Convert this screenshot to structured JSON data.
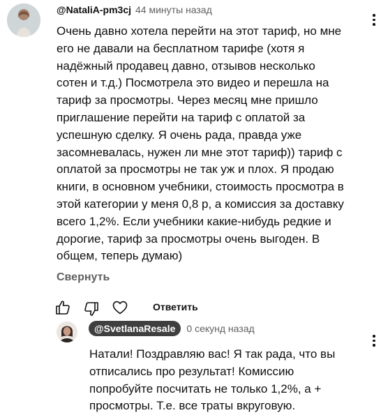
{
  "comment": {
    "author": "@NataliA-pm3cj",
    "time": "44 минуты назад",
    "lines": [
      "Очень давно хотела перейти на этот тариф, но мне",
      "его не давали на бесплатном тарифе (хотя я",
      "надёжный продавец давно, отзывов несколько",
      "сотен и т.д.) Посмотрела это видео и перешла на",
      "тариф за просмотры. Через месяц мне пришло",
      "приглашение перейти на тариф с оплатой за",
      "успешную сделку. Я очень рада, правда уже",
      "засомневалась, нужен ли мне этот тариф)) тариф с",
      "оплатой за просмотры не так уж и плох. Я продаю",
      "книги, в основном учебники, стоимость просмотра в",
      "этой категории у меня 0,8 р, а комиссия за доставку",
      "всего 1,2%. Если учебники какие-нибудь редкие и",
      "дорогие, тариф за просмотры очень выгоден. В",
      "общем, теперь думаю)"
    ],
    "collapse_label": "Свернуть",
    "reply_label": "Ответить"
  },
  "reply": {
    "author": "@SvetlanaResale",
    "time": "0 секунд назад",
    "lines": [
      "Натали! Поздравляю вас! Я так рада, что вы",
      "отписались про результат! Комиссию",
      "попробуйте посчитать не только 1,2%, а  +",
      "просмотры. Т.е. все траты вкруговую."
    ]
  },
  "icons": {
    "like": "thumbs-up-icon",
    "dislike": "thumbs-down-icon",
    "heart": "heart-icon",
    "more": "more-vert-icon"
  }
}
